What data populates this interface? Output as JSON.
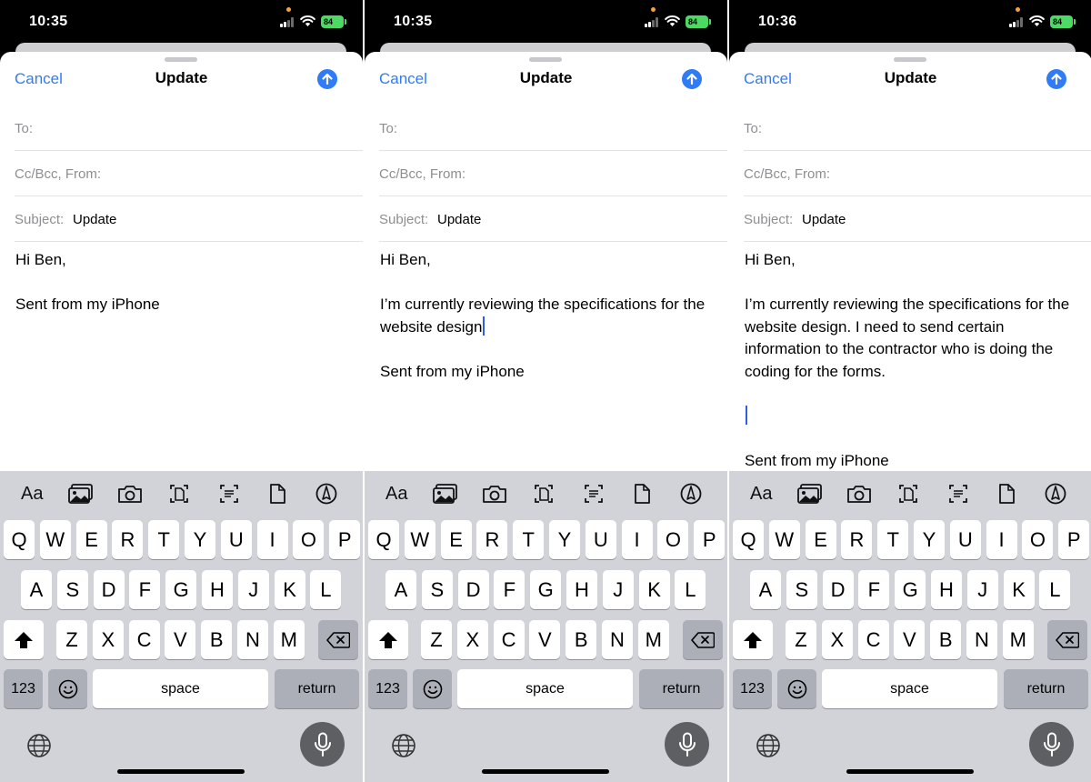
{
  "screens": [
    {
      "status": {
        "time": "10:35",
        "battery": "84"
      },
      "nav": {
        "cancel": "Cancel",
        "title": "Update"
      },
      "fields": {
        "to_label": "To:",
        "cc_label": "Cc/Bcc, From:",
        "subject_label": "Subject:",
        "subject_value": "Update"
      },
      "body": [
        "Hi Ben,",
        "",
        "Sent from my iPhone"
      ],
      "caret_line": -1
    },
    {
      "status": {
        "time": "10:35",
        "battery": "84"
      },
      "nav": {
        "cancel": "Cancel",
        "title": "Update"
      },
      "fields": {
        "to_label": "To:",
        "cc_label": "Cc/Bcc, From:",
        "subject_label": "Subject:",
        "subject_value": "Update"
      },
      "body": [
        "Hi Ben,",
        "",
        "I’m currently reviewing the specifications for the website design",
        "",
        "Sent from my iPhone"
      ],
      "caret_line": 2
    },
    {
      "status": {
        "time": "10:36",
        "battery": "84"
      },
      "nav": {
        "cancel": "Cancel",
        "title": "Update"
      },
      "fields": {
        "to_label": "To:",
        "cc_label": "Cc/Bcc, From:",
        "subject_label": "Subject:",
        "subject_value": "Update"
      },
      "body": [
        "Hi Ben,",
        "",
        "I’m currently reviewing the specifications for the website design. I need to send certain information to the contractor who is doing the coding for the forms.",
        "",
        "",
        "",
        "Sent from my iPhone"
      ],
      "caret_line": 4
    }
  ],
  "keyboard": {
    "toolbar": {
      "format": "Aa",
      "icons": [
        "photo-library-icon",
        "camera-icon",
        "scan-document-icon",
        "scan-text-icon",
        "document-icon",
        "markup-icon"
      ]
    },
    "row1": [
      "Q",
      "W",
      "E",
      "R",
      "T",
      "Y",
      "U",
      "I",
      "O",
      "P"
    ],
    "row2": [
      "A",
      "S",
      "D",
      "F",
      "G",
      "H",
      "J",
      "K",
      "L"
    ],
    "row3": [
      "Z",
      "X",
      "C",
      "V",
      "B",
      "N",
      "M"
    ],
    "numbers": "123",
    "space": "space",
    "return": "return"
  },
  "colors": {
    "accent": "#2f7cf6",
    "caret": "#2f5ce0",
    "keyboard_bg": "#d1d3d9",
    "battery": "#4cd964"
  }
}
